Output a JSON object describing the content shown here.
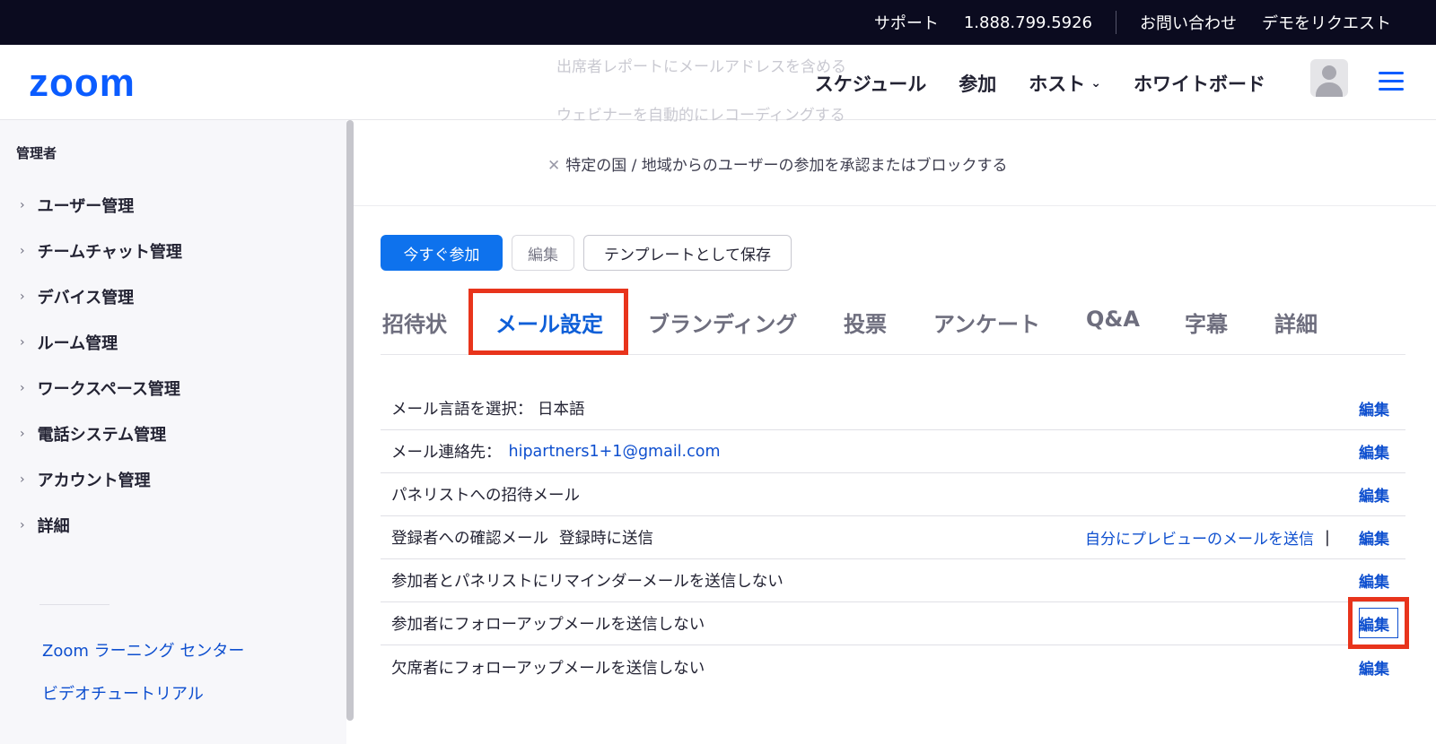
{
  "topbar": {
    "support": "サポート",
    "phone": "1.888.799.5926",
    "contact": "お問い合わせ",
    "demo": "デモをリクエスト"
  },
  "header": {
    "logo": "zoom",
    "faded_line_1": "出席者レポートにメールアドレスを含める",
    "faded_line_2": "ウェビナーを自動的にレコーディングする",
    "nav": {
      "schedule": "スケジュール",
      "join": "参加",
      "host": "ホスト",
      "whiteboard": "ホワイトボード"
    },
    "avatar_icon": "user-avatar-icon",
    "menu_icon": "hamburger-menu-icon",
    "accent": "#0b5cff"
  },
  "sidebar": {
    "title": "管理者",
    "items": [
      {
        "label": "ユーザー管理"
      },
      {
        "label": "チームチャット管理"
      },
      {
        "label": "デバイス管理"
      },
      {
        "label": "ルーム管理"
      },
      {
        "label": "ワークスペース管理"
      },
      {
        "label": "電話システム管理"
      },
      {
        "label": "アカウント管理"
      },
      {
        "label": "詳細"
      }
    ],
    "links": [
      {
        "label": "Zoom ラーニング センター"
      },
      {
        "label": "ビデオチュートリアル"
      }
    ]
  },
  "main": {
    "country_option": "特定の国 / 地域からのユーザーの参加を承認またはブロックする",
    "buttons": {
      "join_now": "今すぐ参加",
      "edit": "編集",
      "save_template": "テンプレートとして保存"
    },
    "tabs": [
      {
        "label": "招待状"
      },
      {
        "label": "メール設定",
        "active": true
      },
      {
        "label": "ブランディング"
      },
      {
        "label": "投票"
      },
      {
        "label": "アンケート"
      },
      {
        "label": "Q&A"
      },
      {
        "label": "字幕"
      },
      {
        "label": "詳細"
      }
    ],
    "rows": [
      {
        "label": "メール言語を選択： 日本語",
        "edit": "編集"
      },
      {
        "label": "メール連絡先：",
        "email": "hipartners1+1@gmail.com",
        "edit": "編集"
      },
      {
        "label": "パネリストへの招待メール",
        "edit": "編集"
      },
      {
        "label": "登録者への確認メール",
        "sub": "登録時に送信",
        "preview": "自分にプレビューのメールを送信",
        "separator": "|",
        "edit": "編集"
      },
      {
        "label": "参加者とパネリストにリマインダーメールを送信しない",
        "edit": "編集"
      },
      {
        "label": "参加者にフォローアップメールを送信しない",
        "edit": "編集"
      },
      {
        "label": "欠席者にフォローアップメールを送信しない",
        "edit": "編集"
      }
    ],
    "highlight_color": "#e8341c"
  }
}
